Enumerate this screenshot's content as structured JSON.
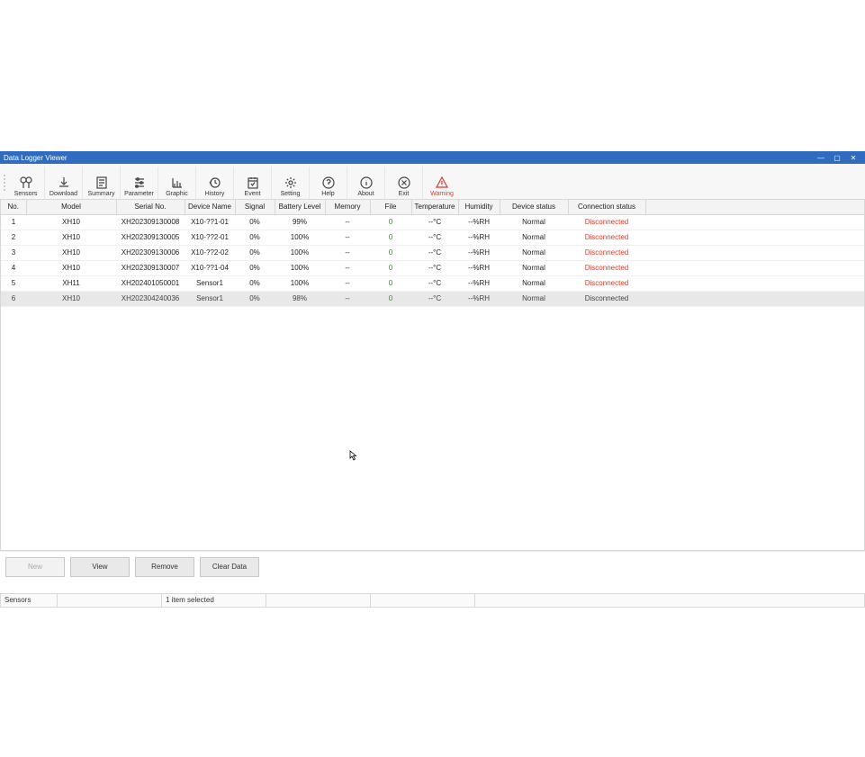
{
  "window": {
    "title": "Data Logger Viewer"
  },
  "toolbar": [
    {
      "id": "sensors",
      "label": "Sensors"
    },
    {
      "id": "download",
      "label": "Download"
    },
    {
      "id": "summary",
      "label": "Summary"
    },
    {
      "id": "parameter",
      "label": "Parameter"
    },
    {
      "id": "graphic",
      "label": "Graphic"
    },
    {
      "id": "history",
      "label": "History"
    },
    {
      "id": "event",
      "label": "Event"
    },
    {
      "id": "setting",
      "label": "Setting"
    },
    {
      "id": "help",
      "label": "Help"
    },
    {
      "id": "about",
      "label": "About"
    },
    {
      "id": "exit",
      "label": "Exit"
    },
    {
      "id": "warning",
      "label": "Warning"
    }
  ],
  "columns": [
    "No.",
    "Model",
    "Serial No.",
    "Device Name",
    "Signal",
    "Battery Level",
    "Memory",
    "File",
    "Temperature",
    "Humidity",
    "Device status",
    "Connection status"
  ],
  "rows": [
    {
      "no": "1",
      "model": "XH10",
      "serial": "XH202309130008",
      "device": "X10-??1-01",
      "signal": "0%",
      "battery": "99%",
      "memory": "--",
      "file": "0",
      "temp": "--°C",
      "humid": "--%RH",
      "status": "Normal",
      "conn": "Disconnected"
    },
    {
      "no": "2",
      "model": "XH10",
      "serial": "XH202309130005",
      "device": "X10-??2-01",
      "signal": "0%",
      "battery": "100%",
      "memory": "--",
      "file": "0",
      "temp": "--°C",
      "humid": "--%RH",
      "status": "Normal",
      "conn": "Disconnected"
    },
    {
      "no": "3",
      "model": "XH10",
      "serial": "XH202309130006",
      "device": "X10-??2-02",
      "signal": "0%",
      "battery": "100%",
      "memory": "--",
      "file": "0",
      "temp": "--°C",
      "humid": "--%RH",
      "status": "Normal",
      "conn": "Disconnected"
    },
    {
      "no": "4",
      "model": "XH10",
      "serial": "XH202309130007",
      "device": "X10-??1-04",
      "signal": "0%",
      "battery": "100%",
      "memory": "--",
      "file": "0",
      "temp": "--°C",
      "humid": "--%RH",
      "status": "Normal",
      "conn": "Disconnected"
    },
    {
      "no": "5",
      "model": "XH11",
      "serial": "XH202401050001",
      "device": "Sensor1",
      "signal": "0%",
      "battery": "100%",
      "memory": "--",
      "file": "0",
      "temp": "--°C",
      "humid": "--%RH",
      "status": "Normal",
      "conn": "Disconnected"
    },
    {
      "no": "6",
      "model": "XH10",
      "serial": "XH202304240036",
      "device": "Sensor1",
      "signal": "0%",
      "battery": "98%",
      "memory": "--",
      "file": "0",
      "temp": "--°C",
      "humid": "--%RH",
      "status": "Normal",
      "conn": "Disconnected",
      "selected": true
    }
  ],
  "actions": {
    "new": "New",
    "view": "View",
    "remove": "Remove",
    "clear": "Clear Data"
  },
  "status": {
    "mode": "Sensors",
    "selection": "1 item selected"
  }
}
